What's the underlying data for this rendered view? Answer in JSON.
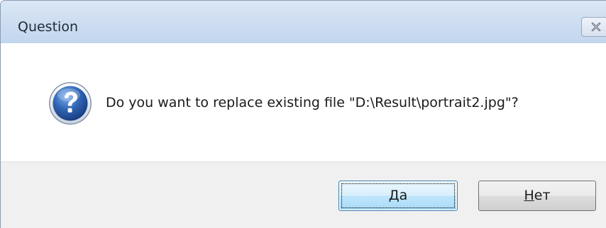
{
  "window": {
    "title": "Question"
  },
  "message": {
    "text": "Do you want to replace existing file \"D:\\Result\\portrait2.jpg\"?"
  },
  "icons": {
    "question": "question-icon",
    "close": "close-icon"
  },
  "buttons": {
    "yes": {
      "mnemonic": "Д",
      "rest": "а"
    },
    "no": {
      "mnemonic": "Н",
      "rest": "ет"
    }
  },
  "colors": {
    "titlebar": "#cfdff1",
    "footer": "#f0f0f0",
    "default_button_border": "#3c7fb1",
    "question_icon": "#2f64b3"
  }
}
